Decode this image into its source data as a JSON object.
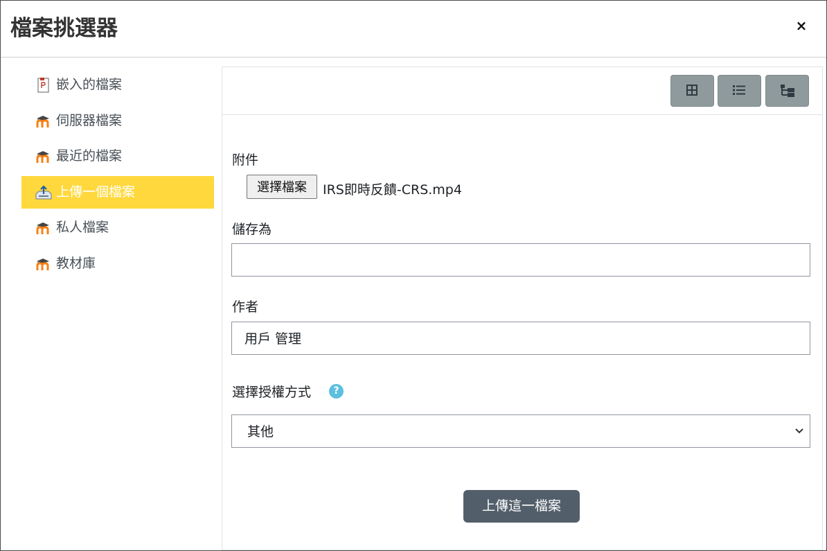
{
  "dialog": {
    "title": "檔案挑選器",
    "close_label": "×"
  },
  "sidebar": {
    "items": [
      {
        "label": "嵌入的檔案",
        "icon": "pdf-file-icon",
        "active": false
      },
      {
        "label": "伺服器檔案",
        "icon": "moodle-logo-icon",
        "active": false
      },
      {
        "label": "最近的檔案",
        "icon": "moodle-logo-icon",
        "active": false
      },
      {
        "label": "上傳一個檔案",
        "icon": "upload-tray-icon",
        "active": true
      },
      {
        "label": "私人檔案",
        "icon": "moodle-logo-icon",
        "active": false
      },
      {
        "label": "教材庫",
        "icon": "moodle-logo-icon",
        "active": false
      }
    ],
    "active_color": "#ffd83d"
  },
  "toolbar": {
    "views": [
      "icon-view-icon",
      "list-view-icon",
      "tree-view-icon"
    ]
  },
  "form": {
    "attachment_label": "附件",
    "choose_file_label": "選擇檔案",
    "chosen_file": "IRS即時反饋-CRS.mp4",
    "save_as_label": "儲存為",
    "save_as_value": "",
    "author_label": "作者",
    "author_value": "用戶 管理",
    "license_label": "選擇授權方式",
    "license_value": "其他",
    "upload_button_label": "上傳這一檔案"
  },
  "colors": {
    "toolbar_button": "#8f9a9c",
    "upload_button": "#525f6a",
    "help_icon": "#5bc0de"
  }
}
